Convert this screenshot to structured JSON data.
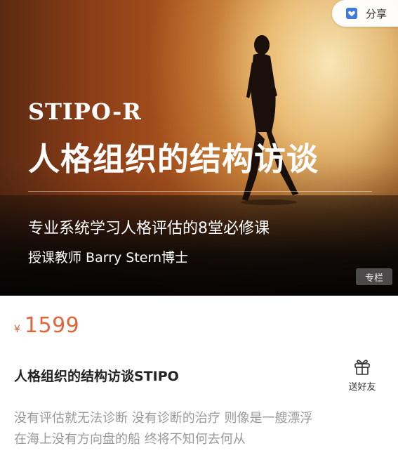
{
  "banner": {
    "subtitle_en": "STIPO-R",
    "title_cn": "人格组织的结构访谈",
    "tagline": "专业系统学习人格评估的8堂必修课",
    "teacher": "授课教师 Barry Stern博士",
    "badge": "专栏"
  },
  "share": {
    "label": "分享",
    "icon": "bookmark-heart-icon"
  },
  "price": {
    "currency": "¥",
    "amount": "1599"
  },
  "course": {
    "title": "人格组织的结构访谈STIPO",
    "description_line1": "没有评估就无法诊断 没有诊断的治疗 则像是一艘漂浮",
    "description_line2": "在海上没有方向盘的船 终将不知何去何从"
  },
  "gift": {
    "label": "送好友",
    "icon": "gift-icon"
  },
  "colors": {
    "price": "#e0643c",
    "share_icon": "#3f7be0"
  }
}
